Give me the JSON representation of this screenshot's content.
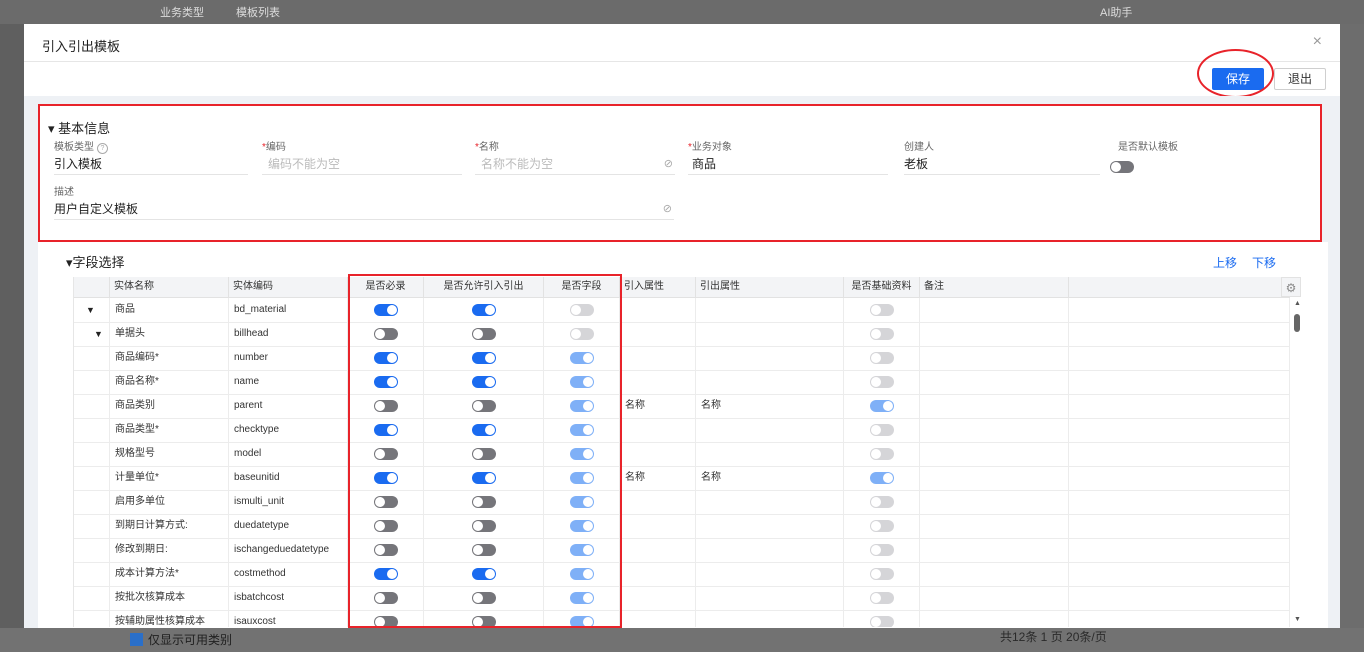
{
  "background": {
    "top_tab": "业务类型",
    "top_tab2": "模板列表",
    "assistant": "AI助手",
    "bottom_checkbox": "仅显示可用类别",
    "bottom_pagination": "共12条   1   页          20条/页"
  },
  "modal": {
    "title": "引入引出模板",
    "close_glyph": "×",
    "save_label": "保存",
    "exit_label": "退出"
  },
  "basic": {
    "section_title": "基本信息",
    "template_type_label": "模板类型",
    "template_type_value": "引入模板",
    "code_label": "编码",
    "code_placeholder": "编码不能为空",
    "name_label": "名称",
    "name_placeholder": "名称不能为空",
    "biz_object_label": "业务对象",
    "biz_object_value": "商品",
    "creator_label": "创建人",
    "creator_value": "老板",
    "default_label": "是否默认模板",
    "desc_label": "描述",
    "desc_value": "用户自定义模板",
    "required_mark": "*"
  },
  "fields": {
    "section_title": "字段选择",
    "move_up": "上移",
    "move_down": "下移",
    "columns": [
      "实体名称",
      "实体编码",
      "是否必录",
      "是否允许引入引出",
      "是否字段",
      "引入属性",
      "引出属性",
      "是否基础资料",
      "备注"
    ],
    "rows": [
      {
        "name": "商品",
        "code": "bd_material",
        "indent": 0,
        "expand": "▼",
        "required": "on",
        "allow": "on",
        "field": "doff",
        "in_attr": "",
        "out_attr": "",
        "basic": "doff"
      },
      {
        "name": "单据头",
        "code": "billhead",
        "indent": 1,
        "expand": "▼",
        "required": "off",
        "allow": "off",
        "field": "doff",
        "in_attr": "",
        "out_attr": "",
        "basic": "doff"
      },
      {
        "name": "商品编码*",
        "code": "number",
        "indent": 2,
        "expand": "",
        "required": "on",
        "allow": "on",
        "field": "don",
        "in_attr": "",
        "out_attr": "",
        "basic": "doff"
      },
      {
        "name": "商品名称*",
        "code": "name",
        "indent": 2,
        "expand": "",
        "required": "on",
        "allow": "on",
        "field": "don",
        "in_attr": "",
        "out_attr": "",
        "basic": "doff"
      },
      {
        "name": "商品类别",
        "code": "parent",
        "indent": 2,
        "expand": "",
        "required": "off",
        "allow": "off",
        "field": "don",
        "in_attr": "名称",
        "out_attr": "名称",
        "basic": "don"
      },
      {
        "name": "商品类型*",
        "code": "checktype",
        "indent": 2,
        "expand": "",
        "required": "on",
        "allow": "on",
        "field": "don",
        "in_attr": "",
        "out_attr": "",
        "basic": "doff"
      },
      {
        "name": "规格型号",
        "code": "model",
        "indent": 2,
        "expand": "",
        "required": "off",
        "allow": "off",
        "field": "don",
        "in_attr": "",
        "out_attr": "",
        "basic": "doff"
      },
      {
        "name": "计量单位*",
        "code": "baseunitid",
        "indent": 2,
        "expand": "",
        "required": "on",
        "allow": "on",
        "field": "don",
        "in_attr": "名称",
        "out_attr": "名称",
        "basic": "don"
      },
      {
        "name": "启用多单位",
        "code": "ismulti_unit",
        "indent": 2,
        "expand": "",
        "required": "off",
        "allow": "off",
        "field": "don",
        "in_attr": "",
        "out_attr": "",
        "basic": "doff"
      },
      {
        "name": "到期日计算方式:",
        "code": "duedatetype",
        "indent": 2,
        "expand": "",
        "required": "off",
        "allow": "off",
        "field": "don",
        "in_attr": "",
        "out_attr": "",
        "basic": "doff"
      },
      {
        "name": "修改到期日:",
        "code": "ischangeduedatetype",
        "indent": 2,
        "expand": "",
        "required": "off",
        "allow": "off",
        "field": "don",
        "in_attr": "",
        "out_attr": "",
        "basic": "doff"
      },
      {
        "name": "成本计算方法*",
        "code": "costmethod",
        "indent": 2,
        "expand": "",
        "required": "on",
        "allow": "on",
        "field": "don",
        "in_attr": "",
        "out_attr": "",
        "basic": "doff"
      },
      {
        "name": "按批次核算成本",
        "code": "isbatchcost",
        "indent": 2,
        "expand": "",
        "required": "off",
        "allow": "off",
        "field": "don",
        "in_attr": "",
        "out_attr": "",
        "basic": "doff"
      },
      {
        "name": "按辅助属性核算成本",
        "code": "isauxcost",
        "indent": 2,
        "expand": "",
        "required": "off",
        "allow": "off",
        "field": "don",
        "in_attr": "",
        "out_attr": "",
        "basic": "doff"
      }
    ]
  },
  "colors": {
    "accent": "#1a6bf0",
    "highlight": "#e8232a"
  }
}
